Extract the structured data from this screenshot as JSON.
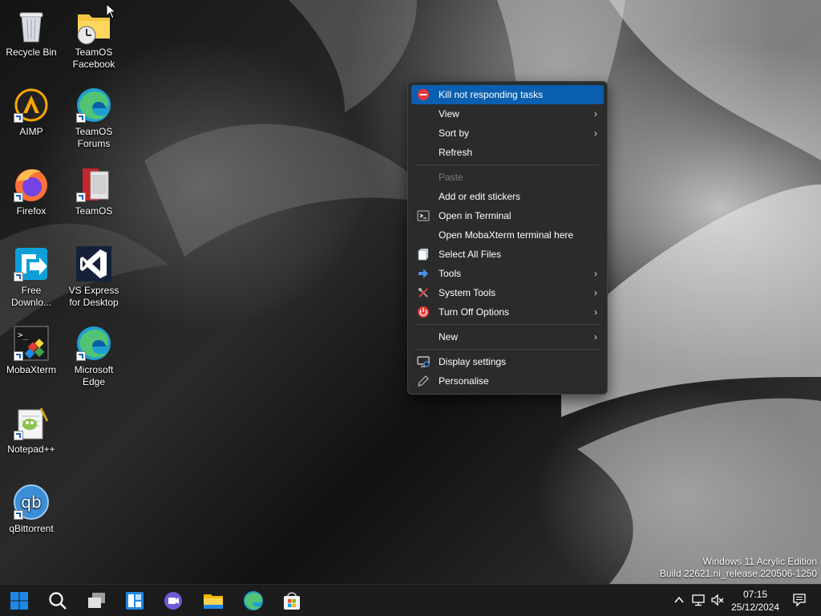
{
  "desktop_icons": [
    {
      "label": "Recycle Bin",
      "icon": "recycle-bin-icon"
    },
    {
      "label": "TeamOS Facebook",
      "icon": "folder-clock-icon"
    },
    {
      "label": "AIMP",
      "icon": "aimp-icon"
    },
    {
      "label": "TeamOS Forums",
      "icon": "edge-icon"
    },
    {
      "label": "Firefox",
      "icon": "firefox-icon"
    },
    {
      "label": "TeamOS",
      "icon": "teamos-icon"
    },
    {
      "label": "Free Downlo...",
      "icon": "free-download-icon"
    },
    {
      "label": "VS Express for Desktop",
      "icon": "visual-studio-icon"
    },
    {
      "label": "MobaXterm",
      "icon": "mobaxterm-icon"
    },
    {
      "label": "Microsoft Edge",
      "icon": "edge-icon"
    },
    {
      "label": "Notepad++",
      "icon": "notepadpp-icon"
    },
    {
      "label": "qBittorrent",
      "icon": "qbittorrent-icon"
    }
  ],
  "context_menu": {
    "items": [
      {
        "label": "Kill not responding tasks",
        "icon": "stop-icon"
      },
      {
        "label": "View",
        "icon": ""
      },
      {
        "label": "Sort by",
        "icon": ""
      },
      {
        "label": "Refresh",
        "icon": ""
      },
      {
        "label": "Paste",
        "icon": ""
      },
      {
        "label": "Add or edit stickers",
        "icon": ""
      },
      {
        "label": "Open in Terminal",
        "icon": "terminal-icon"
      },
      {
        "label": "Open MobaXterm terminal here",
        "icon": ""
      },
      {
        "label": "Select All Files",
        "icon": "files-icon"
      },
      {
        "label": "Tools",
        "icon": "arrow-right-icon"
      },
      {
        "label": "System Tools",
        "icon": "tools-icon"
      },
      {
        "label": "Turn Off Options",
        "icon": "power-icon"
      },
      {
        "label": "New",
        "icon": ""
      },
      {
        "label": "Display settings",
        "icon": "display-icon"
      },
      {
        "label": "Personalise",
        "icon": "pen-icon"
      }
    ],
    "highlighted": "Kill not responding tasks",
    "disabled": [
      "Paste"
    ],
    "submenus": [
      "View",
      "Sort by",
      "Tools",
      "System Tools",
      "Turn Off Options",
      "New"
    ],
    "submenu_arrow": "›"
  },
  "watermark": {
    "line1": "Windows 11 Acrylic Edition",
    "line2": "Build 22621.ni_release.220506-1250"
  },
  "taskbar": {
    "pinned": [
      "start-icon",
      "search-icon",
      "task-view-icon",
      "widgets-icon",
      "teams-chat-icon",
      "file-explorer-icon",
      "edge-icon",
      "store-icon"
    ],
    "tray": [
      "chevron-up-icon",
      "network-icon",
      "volume-muted-icon",
      "notification-icon"
    ],
    "time": "07:15",
    "date": "25/12/2024"
  },
  "colors": {
    "menu_bg": "#2b2b2b",
    "highlight": "#0a5fb0",
    "taskbar_bg": "#1c1c1c",
    "accent_blue": "#0078d4"
  }
}
